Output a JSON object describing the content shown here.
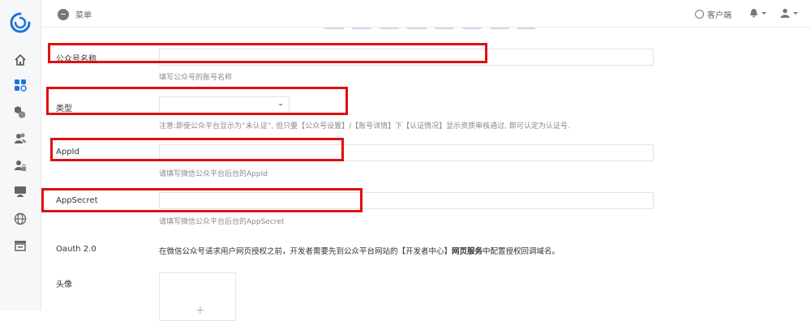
{
  "topbar": {
    "menu_label": "菜单",
    "client_label": "客户端"
  },
  "sidebar": {
    "items": [
      {
        "icon": "home-icon"
      },
      {
        "icon": "apps-icon"
      },
      {
        "icon": "cubes-icon"
      },
      {
        "icon": "users-icon"
      },
      {
        "icon": "user-lock-icon"
      },
      {
        "icon": "monitor-icon"
      },
      {
        "icon": "globe-icon"
      },
      {
        "icon": "store-icon"
      }
    ]
  },
  "form": {
    "name_label": "公众号名称",
    "name_help": "填写公众号的账号名称",
    "type_label": "类型",
    "type_value": "",
    "type_help": "注意:即使公众平台显示为“未认证”, 但只要【公众号设置】/【账号详情】下【认证情况】显示资质审核通过, 即可认定为认证号.",
    "appid_label": "AppId",
    "appid_help": "请填写微信公众平台后台的AppId",
    "secret_label": "AppSecret",
    "secret_help": "请填写微信公众平台后台的AppSecret",
    "oauth_label": "Oauth 2.0",
    "oauth_text_pre": "在微信公众号请求用户网页授权之前，开发者需要先到公众平台网站的【开发者中心】",
    "oauth_text_bold": "网页服务",
    "oauth_text_post": "中配置授权回调域名。",
    "avatar_label": "头像",
    "avatar_plus": "+"
  },
  "colors": {
    "accent": "#1e73d8",
    "highlight": "#e01010"
  }
}
